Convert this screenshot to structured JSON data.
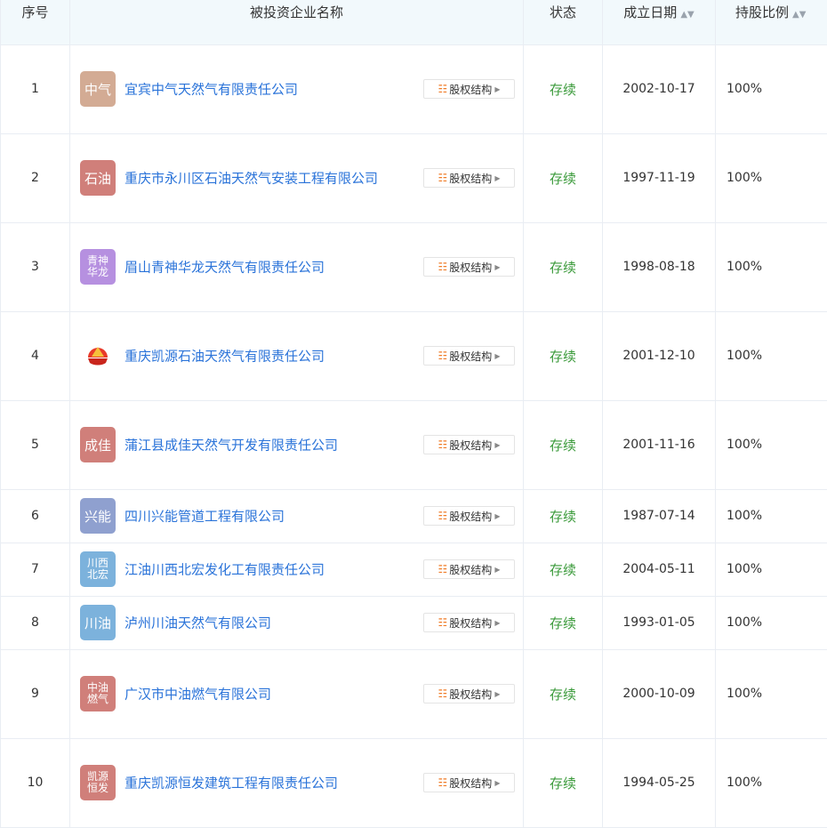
{
  "colors": {
    "header_bg": "#f2f9fc",
    "link": "#2a73d9",
    "status": "#3a9a3a",
    "equity_icon": "#ef7b26"
  },
  "header": {
    "no": "序号",
    "company": "被投资企业名称",
    "status": "状态",
    "date": "成立日期",
    "ratio": "持股比例",
    "sort_icon": "sort-icon"
  },
  "equity_button_label": "股权结构",
  "rows": [
    {
      "no": "1",
      "logo": {
        "l1": "中气",
        "l2": "",
        "color": "#d3ab94"
      },
      "name": "宜宾中气天然气有限责任公司",
      "status": "存续",
      "date": "2002-10-17",
      "ratio": "100%"
    },
    {
      "no": "2",
      "logo": {
        "l1": "石油",
        "l2": "",
        "color": "#d07f7a"
      },
      "name": "重庆市永川区石油天然气安装工程有限公司",
      "status": "存续",
      "date": "1997-11-19",
      "ratio": "100%"
    },
    {
      "no": "3",
      "logo": {
        "l1": "青神",
        "l2": "华龙",
        "color": "#b690e0"
      },
      "name": "眉山青神华龙天然气有限责任公司",
      "status": "存续",
      "date": "1998-08-18",
      "ratio": "100%"
    },
    {
      "no": "4",
      "logo": {
        "l1": "",
        "l2": "",
        "color": "#ffffff",
        "icon": "petrochina-logo-icon"
      },
      "name": "重庆凯源石油天然气有限责任公司",
      "status": "存续",
      "date": "2001-12-10",
      "ratio": "100%"
    },
    {
      "no": "5",
      "logo": {
        "l1": "成佳",
        "l2": "",
        "color": "#d07f7a"
      },
      "name": "蒲江县成佳天然气开发有限责任公司",
      "status": "存续",
      "date": "2001-11-16",
      "ratio": "100%"
    },
    {
      "no": "6",
      "logo": {
        "l1": "兴能",
        "l2": "",
        "color": "#8fa0cf"
      },
      "name": "四川兴能管道工程有限公司",
      "status": "存续",
      "date": "1987-07-14",
      "ratio": "100%"
    },
    {
      "no": "7",
      "logo": {
        "l1": "川西",
        "l2": "北宏",
        "color": "#7cb2dc"
      },
      "name": "江油川西北宏发化工有限责任公司",
      "status": "存续",
      "date": "2004-05-11",
      "ratio": "100%"
    },
    {
      "no": "8",
      "logo": {
        "l1": "川油",
        "l2": "",
        "color": "#7cb2dc"
      },
      "name": "泸州川油天然气有限公司",
      "status": "存续",
      "date": "1993-01-05",
      "ratio": "100%"
    },
    {
      "no": "9",
      "logo": {
        "l1": "中油",
        "l2": "燃气",
        "color": "#d07f7a"
      },
      "name": "广汉市中油燃气有限公司",
      "status": "存续",
      "date": "2000-10-09",
      "ratio": "100%"
    },
    {
      "no": "10",
      "logo": {
        "l1": "凯源",
        "l2": "恒发",
        "color": "#d07f7a"
      },
      "name": "重庆凯源恒发建筑工程有限责任公司",
      "status": "存续",
      "date": "1994-05-25",
      "ratio": "100%"
    }
  ]
}
